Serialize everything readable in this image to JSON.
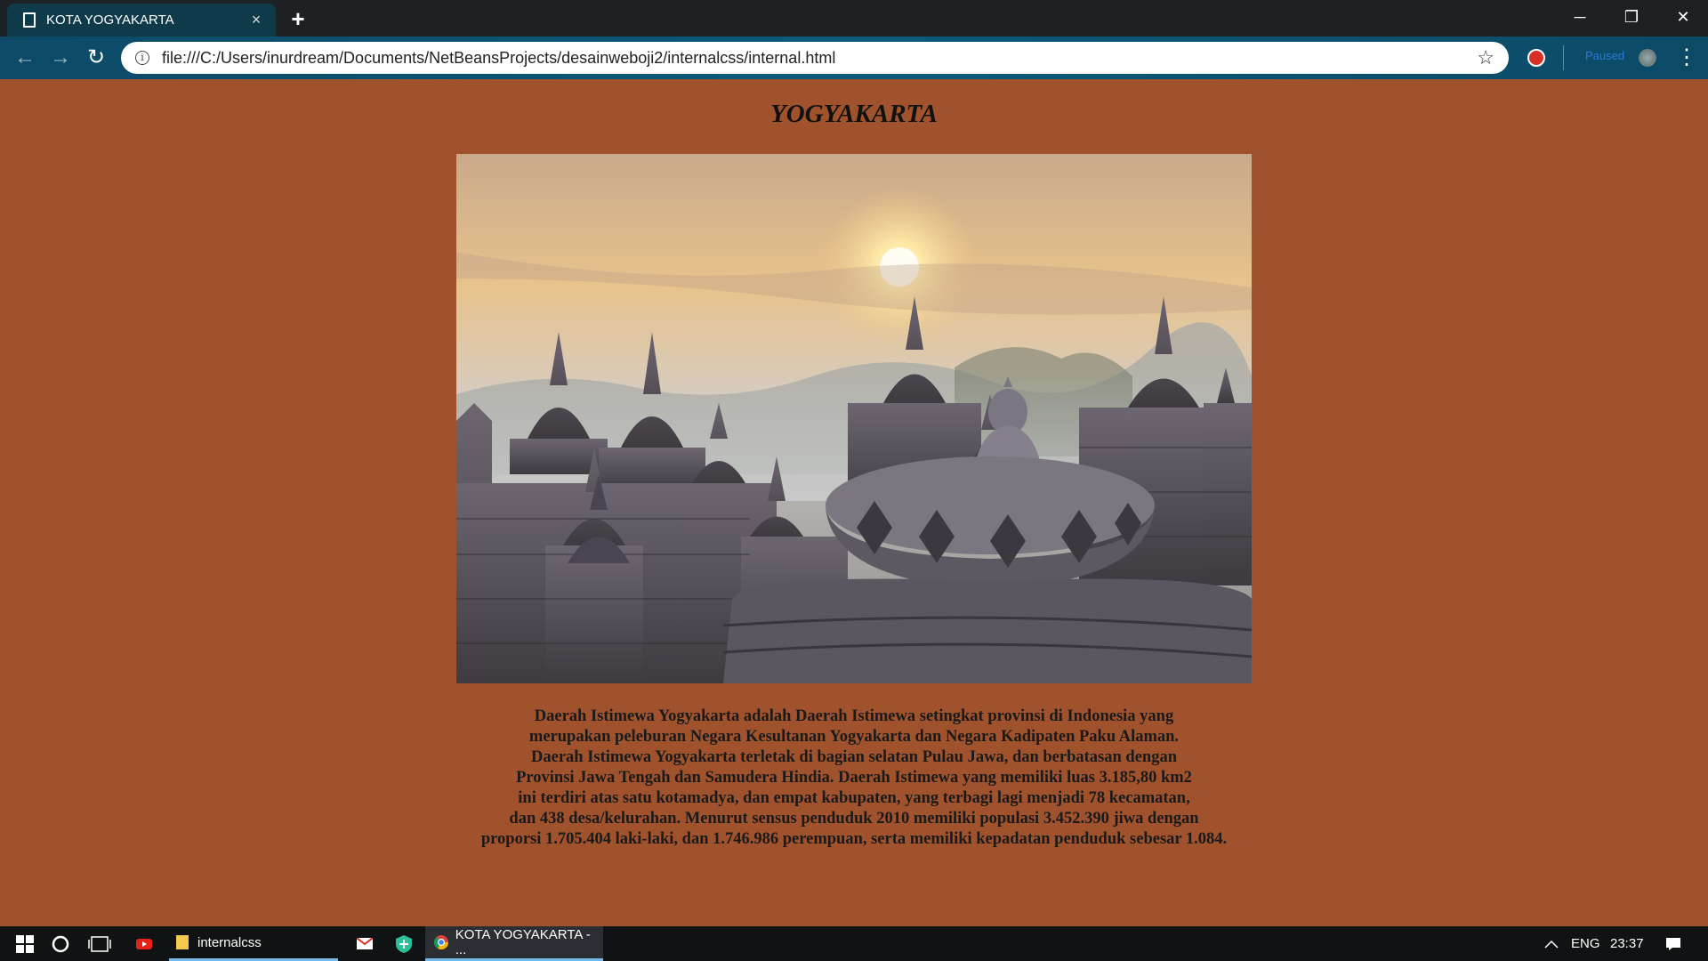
{
  "browser": {
    "tab_title": "KOTA YOGYAKARTA",
    "tab_close": "×",
    "new_tab": "+",
    "window_controls": {
      "minimize": "─",
      "restore": "❐",
      "close": "✕"
    },
    "nav": {
      "back": "←",
      "forward": "→",
      "reload": "↻"
    },
    "info_glyph": "i",
    "url": "file:///C:/Users/inurdream/Documents/NetBeansProjects/desainweboji2/internalcss/internal.html",
    "bookmark_glyph": "☆",
    "paused_label": "Paused",
    "menu_glyph": "⋮"
  },
  "page": {
    "title": "YOGYAKARTA",
    "image_alt": "Borobudur temple stupas at sunrise",
    "paragraph_lines": [
      "Daerah Istimewa Yogyakarta adalah Daerah Istimewa setingkat provinsi di Indonesia yang",
      "merupakan peleburan Negara Kesultanan Yogyakarta dan Negara Kadipaten Paku Alaman.",
      "Daerah Istimewa Yogyakarta terletak di bagian selatan Pulau Jawa, dan berbatasan dengan",
      "Provinsi Jawa Tengah dan Samudera Hindia. Daerah Istimewa yang memiliki luas 3.185,80 km2",
      "ini terdiri atas satu kotamadya, dan empat kabupaten, yang terbagi lagi menjadi 78 kecamatan,",
      "dan 438 desa/kelurahan. Menurut sensus penduduk 2010 memiliki populasi 3.452.390 jiwa dengan",
      "proporsi 1.705.404 laki-laki, dan 1.746.986 perempuan, serta memiliki kepadatan penduduk sebesar 1.084."
    ]
  },
  "taskbar": {
    "items": [
      {
        "label": "internalcss"
      },
      {
        "label": "KOTA YOGYAKARTA - ..."
      }
    ],
    "language": "ENG",
    "time": "23:37"
  },
  "colors": {
    "page_background": "#a0522d",
    "accent": "#76b9ed"
  },
  "icons": [
    "windows-start-icon",
    "cortana-icon",
    "task-view-icon",
    "youtube-icon",
    "folder-icon",
    "mail-icon",
    "shield-icon",
    "chrome-icon",
    "chevron-up-icon",
    "notification-icon"
  ]
}
